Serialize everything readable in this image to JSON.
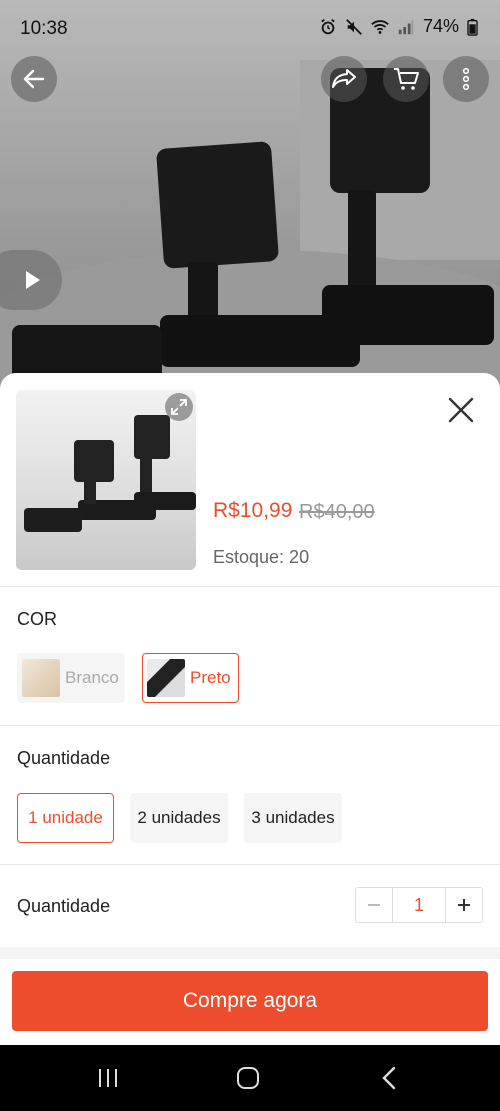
{
  "status_bar": {
    "time": "10:38",
    "battery": "74%",
    "icons": [
      "alarm-icon",
      "mute-icon",
      "wifi-icon",
      "signal-icon"
    ]
  },
  "top_actions": {
    "back_icon": "back-arrow-icon",
    "share_icon": "share-icon",
    "cart_icon": "cart-icon",
    "more_icon": "more-vertical-icon",
    "play_icon": "play-icon"
  },
  "product": {
    "price": "R$10,99",
    "original_price": "R$40,00",
    "stock_label": "Estoque: 20"
  },
  "color_section": {
    "title": "COR",
    "options": [
      {
        "label": "Branco",
        "state": "disabled"
      },
      {
        "label": "Preto",
        "state": "selected"
      }
    ]
  },
  "quantity_pack_section": {
    "title": "Quantidade",
    "options": [
      {
        "label": "1 unidade",
        "state": "selected"
      },
      {
        "label": "2 unidades",
        "state": "normal"
      },
      {
        "label": "3 unidades",
        "state": "normal"
      }
    ]
  },
  "quantity_stepper": {
    "title": "Quantidade",
    "value": "1"
  },
  "buy_button": {
    "label": "Compre agora"
  },
  "colors": {
    "accent": "#ee4d2d",
    "disabled_bg": "#f5f5f5"
  }
}
